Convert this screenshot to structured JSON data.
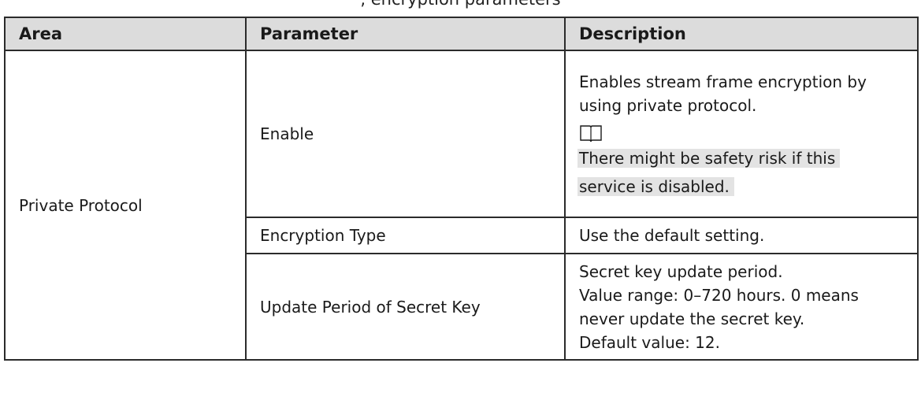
{
  "caption": ", encryption parameters",
  "table": {
    "headers": {
      "area": "Area",
      "parameter": "Parameter",
      "description": "Description"
    },
    "area_label": "Private Protocol",
    "rows": [
      {
        "parameter": "Enable",
        "description_lines": [
          "Enables stream frame encryption by",
          "using private protocol."
        ],
        "note_icon": "open-book-icon",
        "note_lines": [
          "There might be safety risk if this",
          "service is disabled."
        ]
      },
      {
        "parameter": "Encryption Type",
        "description_lines": [
          "Use the default setting."
        ]
      },
      {
        "parameter": "Update Period of Secret Key",
        "description_lines": [
          "Secret key update period.",
          "Value range: 0–720 hours. 0 means",
          "never update the secret key.",
          "Default value: 12."
        ]
      }
    ]
  }
}
